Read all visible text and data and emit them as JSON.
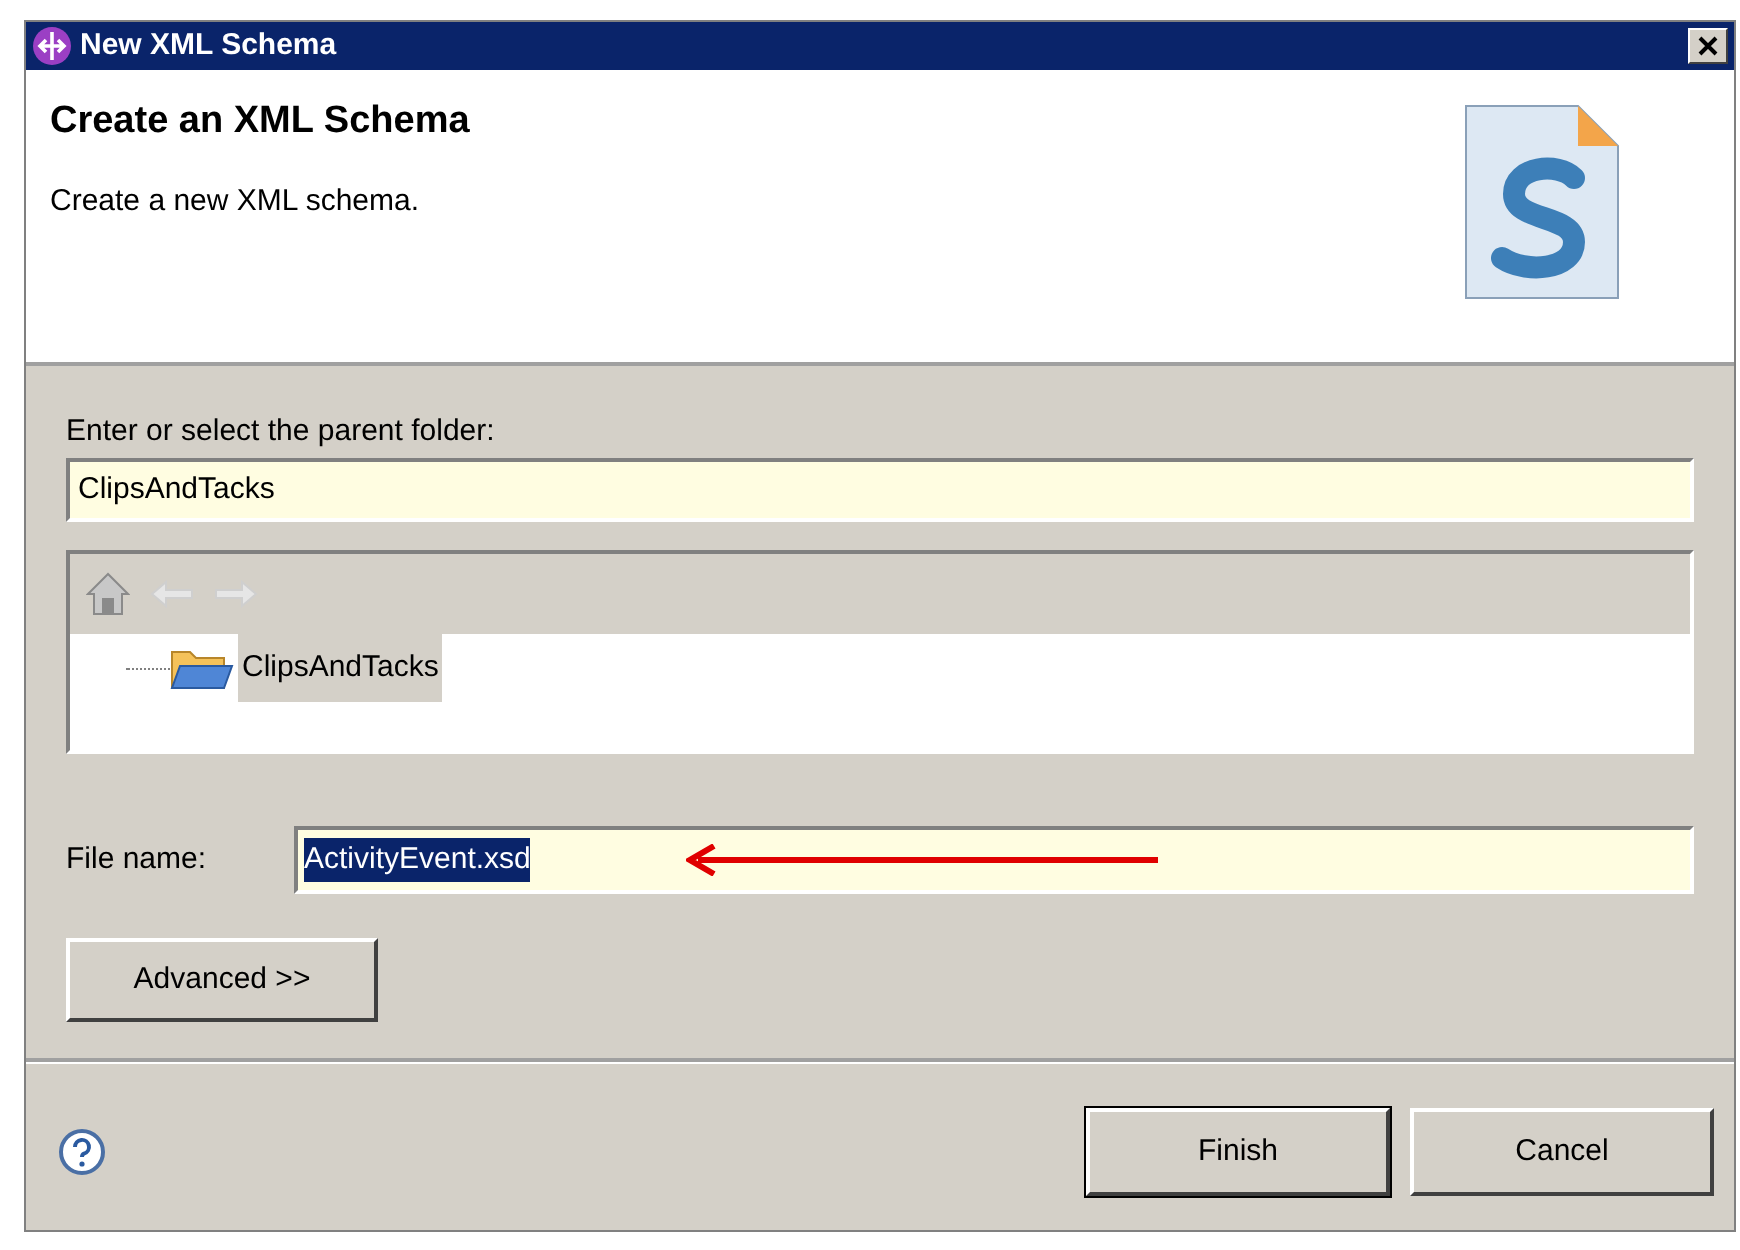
{
  "window": {
    "title": "New XML Schema"
  },
  "header": {
    "title": "Create an XML Schema",
    "description": "Create a new XML schema."
  },
  "parent_folder": {
    "label": "Enter or select the parent folder:",
    "value": "ClipsAndTacks"
  },
  "tree": {
    "items": [
      {
        "label": "ClipsAndTacks",
        "selected": true
      }
    ]
  },
  "file_name": {
    "label": "File name:",
    "value": "ActivityEvent.xsd",
    "selected": true
  },
  "advanced_button": "Advanced >>",
  "buttons": [
    {
      "label": "Finish",
      "default": true
    },
    {
      "label": "Cancel",
      "default": false
    }
  ]
}
